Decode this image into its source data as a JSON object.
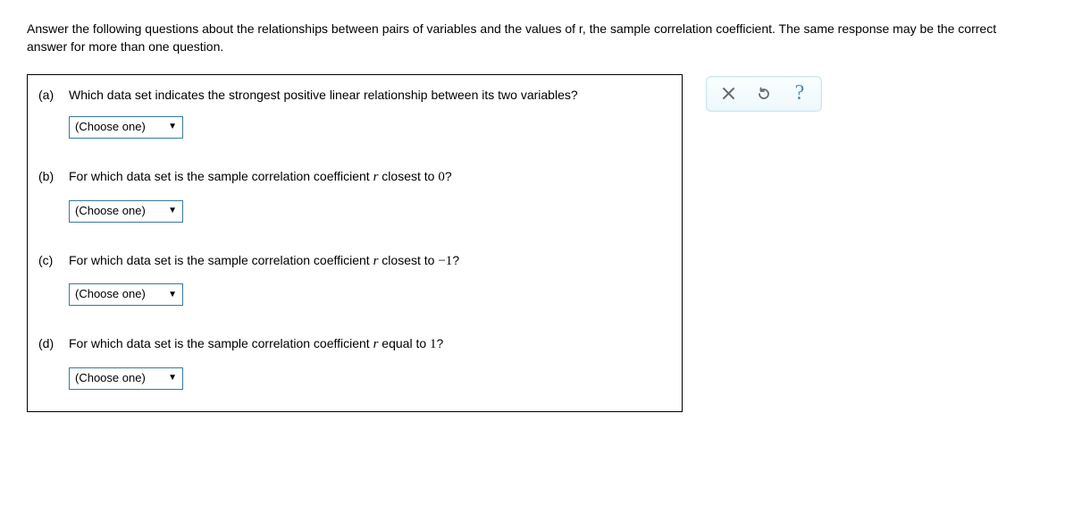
{
  "instructions": "Answer the following questions about the relationships between pairs of variables and the values of r, the sample correlation coefficient. The same response may be the correct answer for more than one question.",
  "dropdown_placeholder": "(Choose one)",
  "questions": {
    "a": {
      "label": "(a)",
      "text": "Which data set indicates the strongest positive linear relationship between its two variables?"
    },
    "b": {
      "label": "(b)",
      "text_pre": "For which data set is the sample correlation coefficient ",
      "var": "r",
      "text_mid": " closest to ",
      "value": "0",
      "text_post": "?"
    },
    "c": {
      "label": "(c)",
      "text_pre": "For which data set is the sample correlation coefficient ",
      "var": "r",
      "text_mid": " closest to ",
      "value": "−1",
      "text_post": "?"
    },
    "d": {
      "label": "(d)",
      "text_pre": "For which data set is the sample correlation coefficient ",
      "var": "r",
      "text_mid": " equal to ",
      "value": "1",
      "text_post": "?"
    }
  },
  "toolbox": {
    "clear": "clear",
    "reset": "reset",
    "help": "?"
  }
}
